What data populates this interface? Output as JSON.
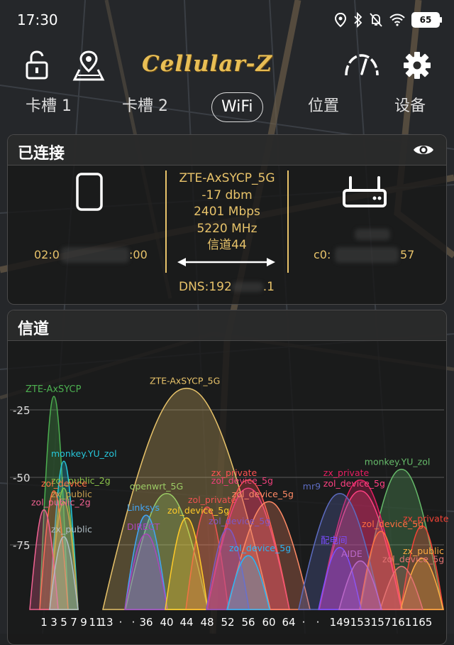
{
  "status_bar": {
    "time": "17:30",
    "battery": "65",
    "icons": [
      "location-icon",
      "bluetooth-icon",
      "silent-bell-icon",
      "wifi-icon",
      "battery-icon"
    ]
  },
  "toolbar": {
    "app_name": "Cellular-Z",
    "icons": [
      "unlock-icon",
      "map-pin-icon",
      "speedometer-icon",
      "gear-icon"
    ]
  },
  "tabs": [
    {
      "label": "卡槽 1",
      "active": false
    },
    {
      "label": "卡槽 2",
      "active": false
    },
    {
      "label": "WiFi",
      "active": true
    },
    {
      "label": "位置",
      "active": false
    },
    {
      "label": "设备",
      "active": false
    }
  ],
  "connected": {
    "title": "已连接",
    "device_mac": "02:0",
    "device_mac_tail": ":00",
    "ssid": "ZTE-AxSYCP_5G",
    "signal": "-17 dbm",
    "speed": "2401 Mbps",
    "frequency": "5220 MHz",
    "channel": "信道44",
    "router_mac": "c0:",
    "router_mac_tail": "57",
    "dns": "DNS:192",
    "dns_tail": ".1",
    "accent_color": "#e8c36a"
  },
  "channel_panel": {
    "title": "信道"
  },
  "chart_data": {
    "type": "area",
    "y_ticks": [
      "-25",
      "-50",
      "-75"
    ],
    "x_ticks": [
      "1",
      "3",
      "5",
      "7",
      "9",
      "11",
      "13",
      "·",
      "·",
      "36",
      "40",
      "44",
      "48",
      "52",
      "56",
      "60",
      "64",
      "·",
      "·",
      "149",
      "153",
      "157",
      "161",
      "165"
    ],
    "networks": [
      {
        "ssid": "ZTE-AxSYCP",
        "channel": 3,
        "rssi": -20
      },
      {
        "ssid": "ZTE-AxSYCP_5G",
        "channel": 44,
        "rssi": -17
      },
      {
        "ssid": "monkey.YU_zol",
        "channel": 5,
        "rssi": -44
      },
      {
        "ssid": "zol_public_2g",
        "channel": 5,
        "rssi": -54
      },
      {
        "ssid": "zol_device",
        "channel": 3,
        "rssi": -55
      },
      {
        "ssid": "zx_public",
        "channel": 5,
        "rssi": -59
      },
      {
        "ssid": "zol_public_2g",
        "channel": 1,
        "rssi": -62
      },
      {
        "ssid": "zx_public",
        "channel": 5,
        "rssi": -72
      },
      {
        "ssid": "openwrt_5G",
        "channel": 40,
        "rssi": -56
      },
      {
        "ssid": "Linksys",
        "channel": 36,
        "rssi": -64
      },
      {
        "ssid": "DIRECT",
        "channel": 36,
        "rssi": -71
      },
      {
        "ssid": "zol_private",
        "channel": 48,
        "rssi": -61
      },
      {
        "ssid": "zol_device_5g",
        "channel": 44,
        "rssi": -65
      },
      {
        "ssid": "zx_private",
        "channel": 56,
        "rssi": -51
      },
      {
        "ssid": "zol_device_5g",
        "channel": 56,
        "rssi": -54
      },
      {
        "ssid": "zol_device_5g",
        "channel": 60,
        "rssi": -59
      },
      {
        "ssid": "zol_device_5g",
        "channel": 52,
        "rssi": -69
      },
      {
        "ssid": "zol_device_5g",
        "channel": 56,
        "rssi": -79
      },
      {
        "ssid": "monkey.YU_zol",
        "channel": 161,
        "rssi": -47
      },
      {
        "ssid": "zx_private",
        "channel": 153,
        "rssi": -51
      },
      {
        "ssid": "zol_device_5g",
        "channel": 153,
        "rssi": -55
      },
      {
        "ssid": "mr9",
        "channel": 149,
        "rssi": -56
      },
      {
        "ssid": "zx_private",
        "channel": 165,
        "rssi": -68
      },
      {
        "ssid": "zol_device_5g",
        "channel": 157,
        "rssi": -70
      },
      {
        "ssid": "配电间",
        "channel": 149,
        "rssi": -76
      },
      {
        "ssid": "zx_public",
        "channel": 165,
        "rssi": -80
      },
      {
        "ssid": "zol_device_5g",
        "channel": 161,
        "rssi": -83
      },
      {
        "ssid": "AIDE",
        "channel": 153,
        "rssi": -81
      }
    ]
  }
}
